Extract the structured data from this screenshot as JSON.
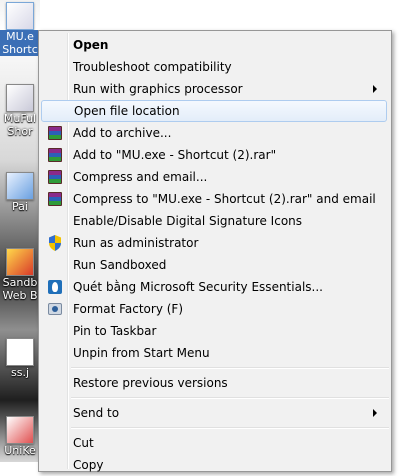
{
  "desktop": {
    "icons": [
      {
        "label": "MU.e",
        "label2": "Shortc",
        "name": "mu-shortcut"
      },
      {
        "label": "MuFul",
        "label2": "Shor",
        "name": "mufull-shortcut"
      },
      {
        "label": "Pai",
        "label2": "",
        "name": "paint-shortcut"
      },
      {
        "label": "Sandb",
        "label2": "Web B",
        "name": "sandboxie-shortcut"
      },
      {
        "label": "ss.j",
        "label2": "",
        "name": "ss-file"
      },
      {
        "label": "UniKe",
        "label2": "",
        "name": "unikey-shortcut"
      }
    ]
  },
  "menu": {
    "items": [
      {
        "label": "Open",
        "bold": true
      },
      {
        "label": "Troubleshoot compatibility"
      },
      {
        "label": "Run with graphics processor",
        "submenu": true
      },
      {
        "label": "Open file location",
        "hover": true
      },
      {
        "label": "Add to archive...",
        "icon": "winrar-icon"
      },
      {
        "label": "Add to \"MU.exe - Shortcut (2).rar\"",
        "icon": "winrar-icon"
      },
      {
        "label": "Compress and email...",
        "icon": "winrar-icon"
      },
      {
        "label": "Compress to \"MU.exe - Shortcut (2).rar\" and email",
        "icon": "winrar-icon"
      },
      {
        "label": "Enable/Disable Digital Signature Icons"
      },
      {
        "label": "Run as administrator",
        "icon": "uac-shield-icon"
      },
      {
        "label": "Run Sandboxed"
      },
      {
        "label": "Quét bằng Microsoft Security Essentials...",
        "icon": "mse-icon"
      },
      {
        "label": "Format Factory (F)",
        "icon": "format-factory-icon"
      },
      {
        "label": "Pin to Taskbar"
      },
      {
        "label": "Unpin from Start Menu"
      },
      {
        "label": "Restore previous versions"
      },
      {
        "label": "Send to",
        "submenu": true
      },
      {
        "label": "Cut"
      },
      {
        "label": "Copy"
      }
    ]
  },
  "colors": {
    "menu_bg": "#f1f1f1",
    "hover_border": "#aeccef",
    "hover_bg": "#e3edf9"
  }
}
